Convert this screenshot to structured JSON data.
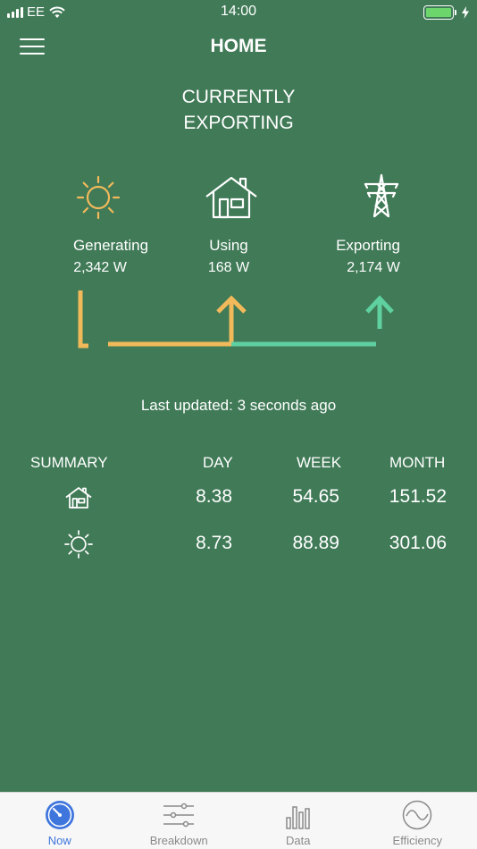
{
  "status_bar": {
    "carrier": "EE",
    "time": "14:00"
  },
  "nav": {
    "title": "HOME"
  },
  "headline": {
    "line1": "CURRENTLY",
    "line2": "EXPORTING"
  },
  "flows": {
    "generating": {
      "label": "Generating",
      "value": "2,342 W"
    },
    "using": {
      "label": "Using",
      "value": "168 W"
    },
    "exporting": {
      "label": "Exporting",
      "value": "2,174 W"
    }
  },
  "last_updated": "Last updated: 3 seconds ago",
  "summary": {
    "headers": {
      "title": "SUMMARY",
      "day": "DAY",
      "week": "WEEK",
      "month": "MONTH"
    },
    "rows": [
      {
        "icon": "house-icon",
        "day": "8.38",
        "week": "54.65",
        "month": "151.52"
      },
      {
        "icon": "sun-icon",
        "day": "8.73",
        "week": "88.89",
        "month": "301.06"
      }
    ]
  },
  "tabs": [
    {
      "label": "Now",
      "icon": "gauge-icon",
      "active": true
    },
    {
      "label": "Breakdown",
      "icon": "sliders-icon",
      "active": false
    },
    {
      "label": "Data",
      "icon": "bar-chart-icon",
      "active": false
    },
    {
      "label": "Efficiency",
      "icon": "wave-icon",
      "active": false
    }
  ],
  "colors": {
    "background": "#407a57",
    "generating": "#f2b95a",
    "exporting": "#5fd0a0",
    "active_tab": "#3f76dd"
  }
}
